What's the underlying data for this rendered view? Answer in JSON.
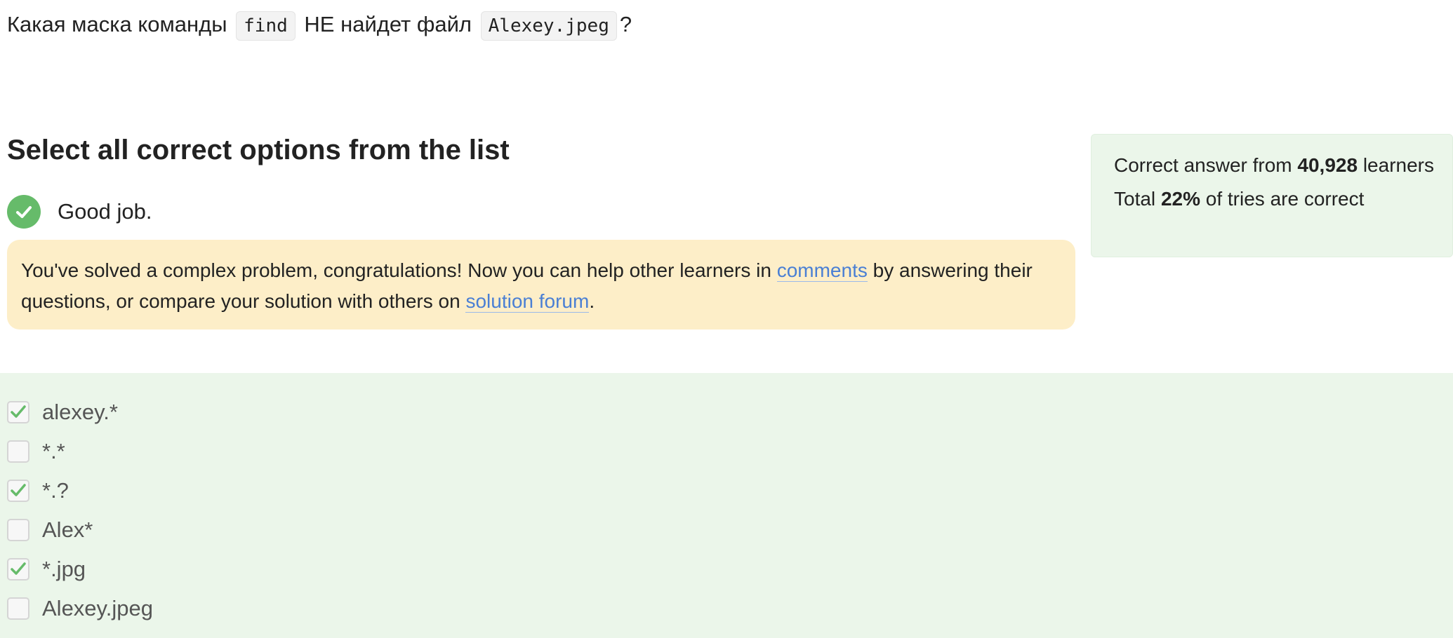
{
  "question": {
    "text_before": "Какая маска команды",
    "code_command": "find",
    "text_middle": "НЕ найдет файл",
    "code_file": "Alexey.jpeg",
    "text_after": "?"
  },
  "heading": "Select all correct options from the list",
  "result": {
    "icon": "check-circle-icon",
    "text": "Good job."
  },
  "notice": {
    "text_1": "You've solved a complex problem, congratulations! Now you can help other learners in ",
    "link_comments": "comments",
    "text_2": " by answering their questions, or compare your solution with others on ",
    "link_forum": "solution forum",
    "text_3": "."
  },
  "stats": {
    "line1_prefix": "Correct answer from ",
    "learners_count": "40,928",
    "line1_suffix": " learners",
    "line2_prefix": "Total ",
    "correct_percent": "22%",
    "line2_suffix": " of tries are correct"
  },
  "options": [
    {
      "label": "alexey.*",
      "checked": true
    },
    {
      "label": "*.*",
      "checked": false
    },
    {
      "label": "*.?",
      "checked": true
    },
    {
      "label": "Alex*",
      "checked": false
    },
    {
      "label": "*.jpg",
      "checked": true
    },
    {
      "label": "Alexey.jpeg",
      "checked": false
    }
  ],
  "colors": {
    "success_green": "#66bb6a",
    "notice_background": "#fdeec8",
    "link_blue": "#4a7fd4",
    "answer_area_background": "#ebf6ea"
  }
}
